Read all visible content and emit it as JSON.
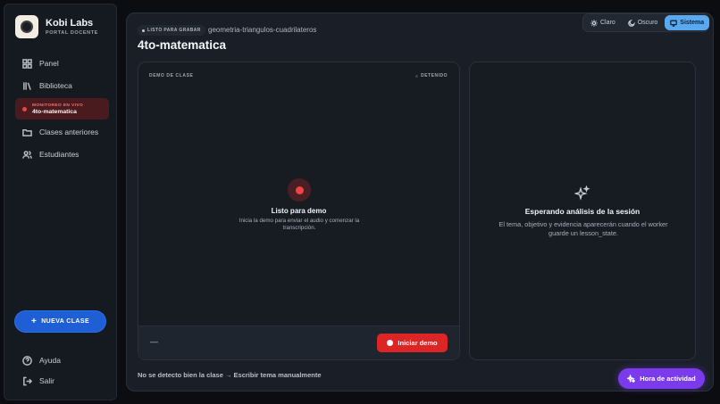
{
  "brand": {
    "name": "Kobi Labs",
    "subtitle": "PORTAL DOCENTE"
  },
  "sidebar": {
    "items": [
      {
        "label": "Panel",
        "icon": "grid-icon"
      },
      {
        "label": "Biblioteca",
        "icon": "library-icon"
      },
      {
        "label": "Clases anteriores",
        "icon": "folder-icon"
      },
      {
        "label": "Estudiantes",
        "icon": "users-icon"
      }
    ],
    "live": {
      "status": "MONITOREO EN VIVO",
      "name": "4to-matematica"
    },
    "new_class": "NUEVA CLASE",
    "help": "Ayuda",
    "logout": "Salir"
  },
  "header": {
    "status": "LISTO PARA GRABAR",
    "slug": "geometria-triangulos-cuadrilateros",
    "title": "4to-matematica"
  },
  "theme": {
    "options": [
      "Claro",
      "Oscuro",
      "Sistema"
    ],
    "selected": "Sistema"
  },
  "demo_panel": {
    "label": "DEMO DE CLASE",
    "state": "DETENIDO",
    "ready_title": "Listo para demo",
    "ready_desc": "Inicia la demo para enviar el audio y comenzar la transcripción.",
    "footer_value": "—",
    "start_button": "Iniciar demo"
  },
  "analysis_panel": {
    "title": "Esperando análisis de la sesión",
    "desc": "El tema, objetivo y evidencia aparecerán cuando el worker guarde un lesson_state."
  },
  "footer": {
    "manual_link": "No se detecto bien la clase → Escribir tema manualmente",
    "activity_button": "Hora de actividad"
  },
  "colors": {
    "accent": "#1f5fd6",
    "danger": "#dc2626",
    "theme_active": "#5aa8ee",
    "activity": "#7c3aed"
  }
}
